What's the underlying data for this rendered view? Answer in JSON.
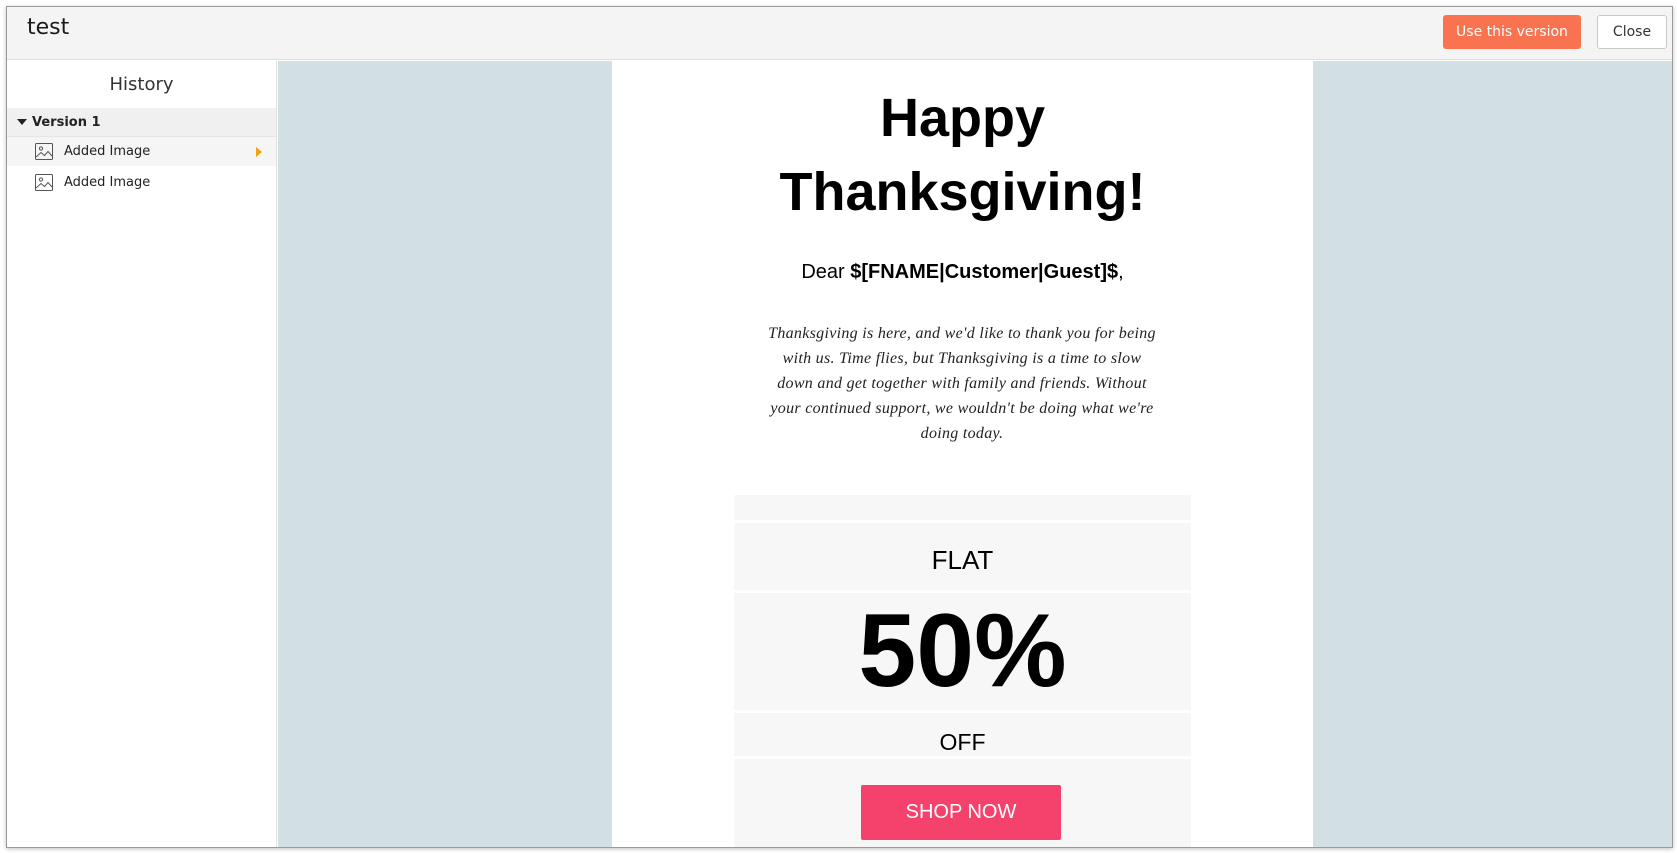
{
  "header": {
    "title": "test",
    "use_version_label": "Use this version",
    "close_label": "Close"
  },
  "sidebar": {
    "title": "History",
    "version_label": "Version 1",
    "items": [
      {
        "label": "Added Image",
        "icon": "image-icon",
        "selected": true
      },
      {
        "label": "Added Image",
        "icon": "image-icon",
        "selected": false
      }
    ]
  },
  "email": {
    "headline_line1": "Happy",
    "headline_line2": "Thanksgiving!",
    "greeting_prefix": "Dear ",
    "greeting_merge_tag": "$[FNAME|Customer|Guest]$",
    "greeting_suffix": ",",
    "body": "Thanksgiving is here, and we'd like to thank you for being with us. Time flies, but Thanksgiving is a time to slow down and get together with family and friends. Without your continued support, we wouldn't be doing what we're doing today.",
    "offer_top": "FLAT",
    "offer_value": "50%",
    "offer_bottom": "OFF",
    "cta_label": "SHOP NOW"
  },
  "colors": {
    "accent_button": "#f97350",
    "cta_button": "#f4426c",
    "canvas_background": "#d2dfe3",
    "selection_caret": "#f2a20c"
  }
}
